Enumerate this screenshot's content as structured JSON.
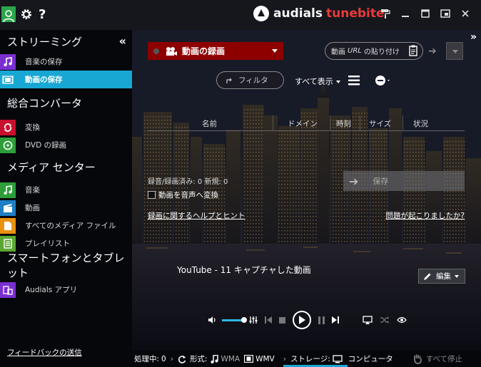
{
  "titlebar": {
    "brand_name": "audials",
    "brand_product": "tunebite"
  },
  "sidebar": {
    "sections": [
      {
        "title": "ストリーミング",
        "items": [
          {
            "label": "音楽の保存",
            "icon": "music-note-icon",
            "color": "#7a2fd0",
            "active": false
          },
          {
            "label": "動画の保存",
            "icon": "film-strip-icon",
            "color": "#18a7d3",
            "active": true
          }
        ]
      },
      {
        "title": "総合コンバータ",
        "items": [
          {
            "label": "変換",
            "icon": "convert-arrows-icon",
            "color": "#c8102e",
            "active": false
          },
          {
            "label": "DVD の録画",
            "icon": "dvd-icon",
            "color": "#2e9e3a",
            "active": false
          }
        ]
      },
      {
        "title": "メディア センター",
        "items": [
          {
            "label": "音楽",
            "icon": "music-notes-icon",
            "color": "#2e9e3a",
            "active": false
          },
          {
            "label": "動画",
            "icon": "film-clapper-icon",
            "color": "#1d7fc4",
            "active": false
          },
          {
            "label": "すべてのメディア ファイル",
            "icon": "document-icon",
            "color": "#e8920f",
            "active": false
          },
          {
            "label": "プレイリスト",
            "icon": "playlist-icon",
            "color": "#5aa832",
            "active": false
          }
        ]
      },
      {
        "title": "スマートフォンとタブレット",
        "items": [
          {
            "label": "Audials アプリ",
            "icon": "devices-icon",
            "color": "#7a2fd0",
            "active": false
          }
        ]
      }
    ],
    "feedback": "フィードバックの送信"
  },
  "main": {
    "mode_label": "動画の録画",
    "url_prefix": "動画",
    "url_italic": "URL",
    "url_suffix": "の貼り付け",
    "filter_placeholder": "フィルタ",
    "show_all": "すべて表示",
    "columns": [
      "名前",
      "ドメイン",
      "時刻",
      "サイズ",
      "状況"
    ],
    "stats": "録音/録画済み: 0   新規: 0",
    "save_label": "保存",
    "convert_label": "動画を音声へ変換",
    "help_link": "録画に関するヘルプとヒント",
    "problem_link": "問題が起こりましたか?",
    "caption": "YouTube - 11 キャプチャした動画",
    "edit_label": "編集",
    "volume_level": 0.85
  },
  "status": {
    "processing_label": "処理中:",
    "processing_count": "0",
    "format_label": "形式:",
    "format_audio": "WMA",
    "format_video": "WMV",
    "storage_label": "ストレージ:",
    "storage_value": "コンピュータ",
    "stop_all": "すべて停止"
  }
}
